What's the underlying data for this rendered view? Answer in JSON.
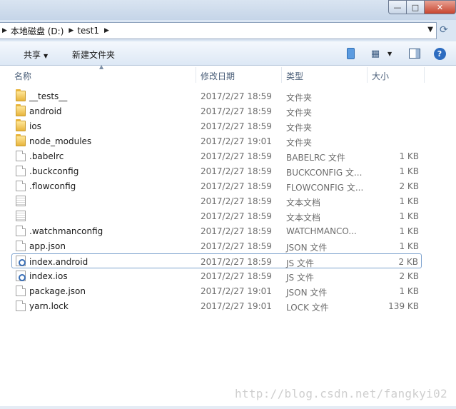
{
  "window": {
    "buttons": {
      "minimize": "—",
      "maximize": "□",
      "close": "✕"
    }
  },
  "address": {
    "breadcrumbs": [
      "本地磁盘 (D:)",
      "test1"
    ]
  },
  "toolbar": {
    "share_label": "共享",
    "new_folder_label": "新建文件夹",
    "help_label": "?"
  },
  "columns": {
    "name": "名称",
    "date": "修改日期",
    "type": "类型",
    "size": "大小"
  },
  "files": [
    {
      "name": "__tests__",
      "date": "2017/2/27 18:59",
      "type": "文件夹",
      "size": "",
      "icon": "folder-icon"
    },
    {
      "name": "android",
      "date": "2017/2/27 18:59",
      "type": "文件夹",
      "size": "",
      "icon": "folder-icon"
    },
    {
      "name": "ios",
      "date": "2017/2/27 18:59",
      "type": "文件夹",
      "size": "",
      "icon": "folder-icon"
    },
    {
      "name": "node_modules",
      "date": "2017/2/27 19:01",
      "type": "文件夹",
      "size": "",
      "icon": "folder-icon"
    },
    {
      "name": ".babelrc",
      "date": "2017/2/27 18:59",
      "type": "BABELRC 文件",
      "size": "1 KB",
      "icon": "file-icon"
    },
    {
      "name": ".buckconfig",
      "date": "2017/2/27 18:59",
      "type": "BUCKCONFIG 文...",
      "size": "1 KB",
      "icon": "file-icon"
    },
    {
      "name": ".flowconfig",
      "date": "2017/2/27 18:59",
      "type": "FLOWCONFIG 文...",
      "size": "2 KB",
      "icon": "file-icon"
    },
    {
      "name": "",
      "date": "2017/2/27 18:59",
      "type": "文本文档",
      "size": "1 KB",
      "icon": "text-icon"
    },
    {
      "name": "",
      "date": "2017/2/27 18:59",
      "type": "文本文档",
      "size": "1 KB",
      "icon": "text-icon"
    },
    {
      "name": ".watchmanconfig",
      "date": "2017/2/27 18:59",
      "type": "WATCHMANCO...",
      "size": "1 KB",
      "icon": "file-icon"
    },
    {
      "name": "app.json",
      "date": "2017/2/27 18:59",
      "type": "JSON 文件",
      "size": "1 KB",
      "icon": "file-icon"
    },
    {
      "name": "index.android",
      "date": "2017/2/27 18:59",
      "type": "JS 文件",
      "size": "2 KB",
      "icon": "js-icon",
      "selected": true
    },
    {
      "name": "index.ios",
      "date": "2017/2/27 18:59",
      "type": "JS 文件",
      "size": "2 KB",
      "icon": "js-icon"
    },
    {
      "name": "package.json",
      "date": "2017/2/27 19:01",
      "type": "JSON 文件",
      "size": "1 KB",
      "icon": "file-icon"
    },
    {
      "name": "yarn.lock",
      "date": "2017/2/27 19:01",
      "type": "LOCK 文件",
      "size": "139 KB",
      "icon": "file-icon"
    }
  ],
  "watermark": "http://blog.csdn.net/fangkyi02"
}
